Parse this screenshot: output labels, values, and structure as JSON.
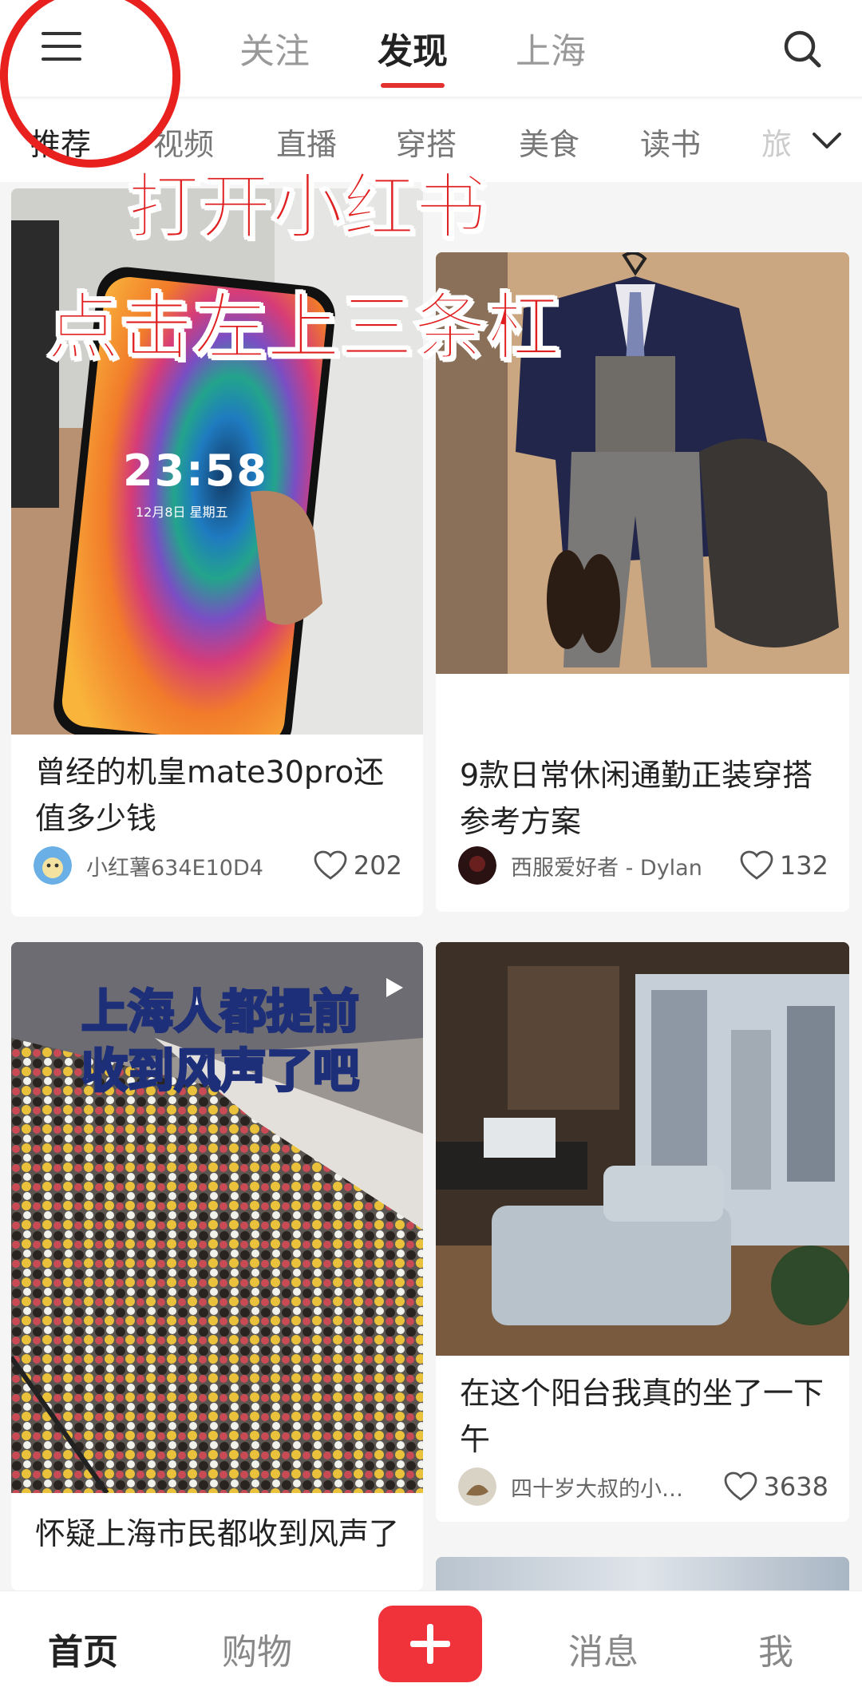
{
  "top_tabs": [
    "关注",
    "发现",
    "上海"
  ],
  "categories": [
    "推荐",
    "视频",
    "直播",
    "穿搭",
    "美食",
    "读书",
    "旅"
  ],
  "annotation": {
    "line1": "打开小红书",
    "line2": "点击左上三条杠"
  },
  "cards": [
    {
      "title": "曾经的机皇mate30pro还值多少钱",
      "author": "小红薯634E10D4",
      "likes": "202",
      "overlay_text": [
        "23:58",
        "12月8日 星期五"
      ]
    },
    {
      "title": "9款日常休闲通勤正装穿搭参考方案",
      "author": "西服爱好者 - Dylan",
      "likes": "132"
    },
    {
      "title": "怀疑上海市民都收到风声了",
      "overlay_text": [
        "上海人都提前",
        "收到风声了吧"
      ]
    },
    {
      "title": "在这个阳台我真的坐了一下午",
      "author": "四十岁大叔的小…",
      "likes": "3638"
    }
  ],
  "bottom_tabs": {
    "home": "首页",
    "shop": "购物",
    "messages": "消息",
    "me": "我"
  },
  "colors": {
    "brand": "#e2312f",
    "annotation": "#e8201e",
    "plus_button": "#f0323a"
  },
  "icons": [
    "menu-icon",
    "search-icon",
    "chevron-down-icon",
    "heart-icon",
    "plus-icon",
    "play-icon"
  ]
}
